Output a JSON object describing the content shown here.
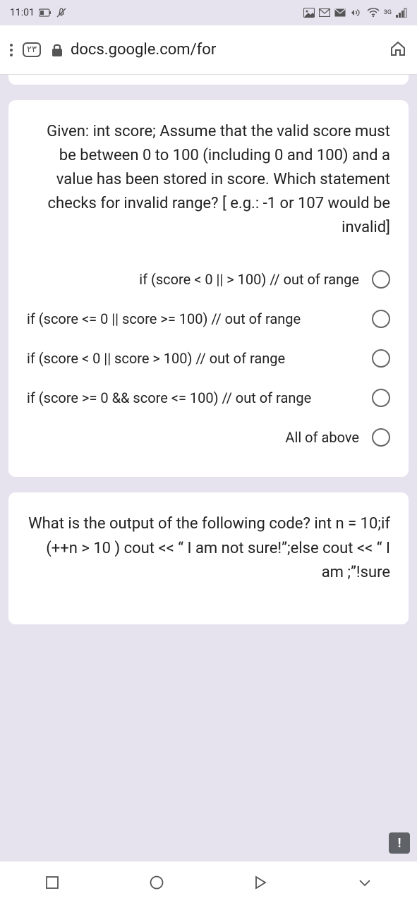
{
  "status": {
    "time": "11:01",
    "network_label": "3G"
  },
  "browser": {
    "tab_count": "٢٣",
    "url": "docs.google.com/for"
  },
  "question1": {
    "text": "Given: int score; Assume that the valid score must be between 0 to 100 (including 0 and 100) and a value has been stored in score. Which statement checks for invalid range? [ e.g.: -1 or 107 would be invalid]",
    "options": [
      "if (score < 0 || > 100) // out of range",
      "if (score <= 0 || score >= 100) // out of range",
      "if (score < 0 || score > 100) // out of range",
      "if (score >= 0 && score <= 100) // out of range",
      "All of above"
    ]
  },
  "question2": {
    "text": "What is the output of the following code? int n = 10;if (++n > 10 ) cout << “ I am not sure!”;else cout << “ I am ;”!sure"
  }
}
